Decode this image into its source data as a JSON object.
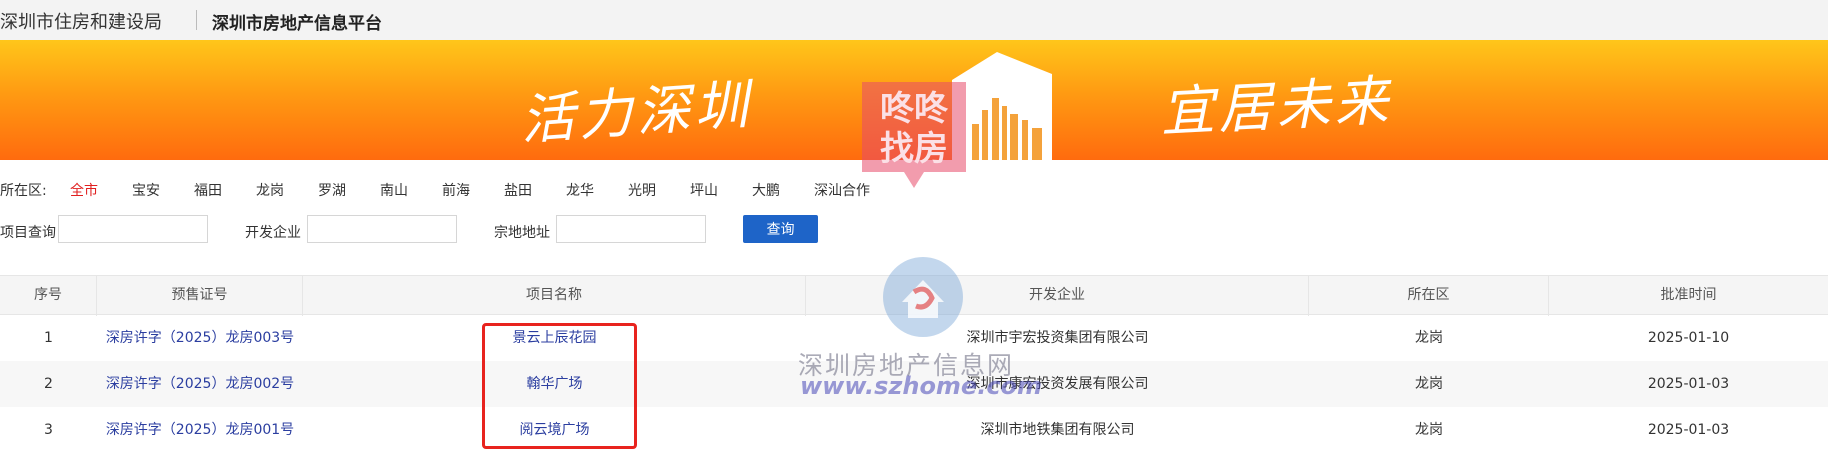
{
  "header": {
    "bureau": "深圳市住房和建设局",
    "platform": "深圳市房地产信息平台"
  },
  "banner": {
    "slogan_left": "活力深圳",
    "slogan_right": "宜居未来",
    "logo_text": "咚咚找房"
  },
  "watermark": {
    "site_name": "深圳房地产信息网",
    "url": "www.szhome.com"
  },
  "filters": {
    "district_label": "所在区:",
    "districts": [
      "全市",
      "宝安",
      "福田",
      "龙岗",
      "罗湖",
      "南山",
      "前海",
      "盐田",
      "龙华",
      "光明",
      "坪山",
      "大鹏",
      "深汕合作"
    ],
    "active_district": "全市",
    "project_label": "项目查询",
    "project_value": "",
    "developer_label": "开发企业",
    "developer_value": "",
    "parcel_label": "宗地地址",
    "parcel_value": "",
    "query_button": "查询"
  },
  "table": {
    "headers": [
      "序号",
      "预售证号",
      "项目名称",
      "开发企业",
      "所在区",
      "批准时间"
    ],
    "rows": [
      {
        "no": "1",
        "permit": "深房许字（2025）龙房003号",
        "project": "景云上辰花园",
        "developer": "深圳市宇宏投资集团有限公司",
        "district": "龙岗",
        "date": "2025-01-10"
      },
      {
        "no": "2",
        "permit": "深房许字（2025）龙房002号",
        "project": "翰华广场",
        "developer": "深圳市康宏投资发展有限公司",
        "district": "龙岗",
        "date": "2025-01-03"
      },
      {
        "no": "3",
        "permit": "深房许字（2025）龙房001号",
        "project": "阅云境广场",
        "developer": "深圳市地铁集团有限公司",
        "district": "龙岗",
        "date": "2025-01-03"
      }
    ]
  },
  "colors": {
    "accent_blue": "#1e64c8",
    "active_red": "#e02020",
    "link_blue": "#2b3ea0",
    "highlight_red": "#e8231e",
    "banner_orange": "#ff7a10"
  }
}
